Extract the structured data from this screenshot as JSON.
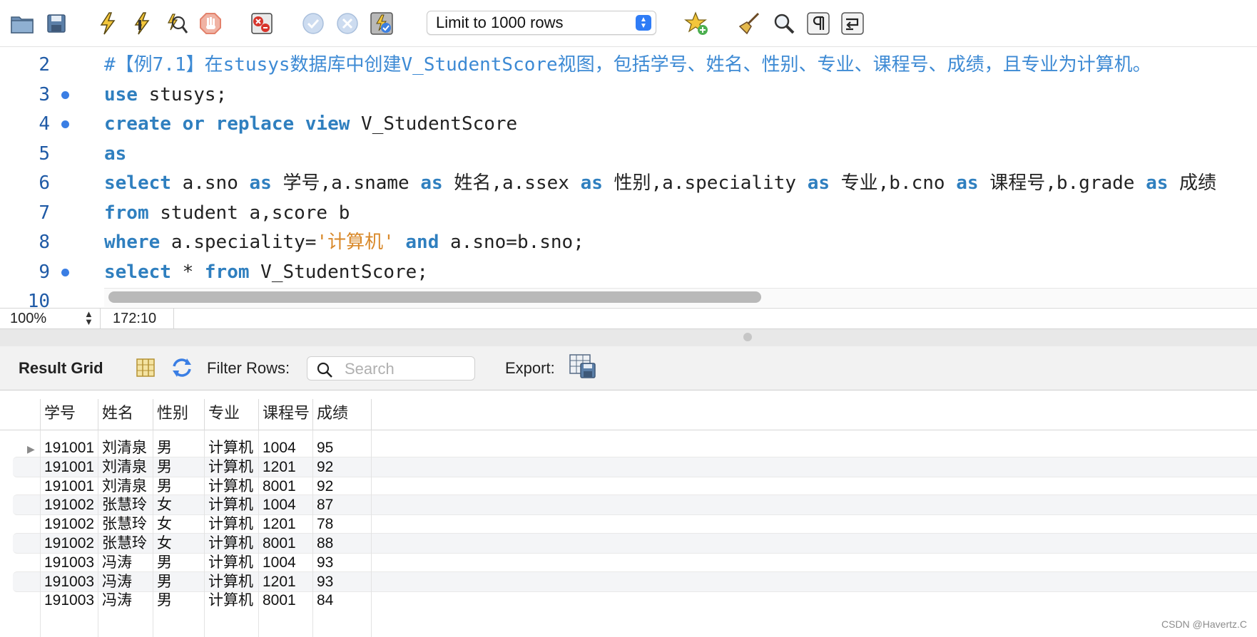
{
  "toolbar": {
    "icons": [
      "open-folder-icon",
      "save-icon",
      "execute-icon",
      "execute-current-icon",
      "explain-icon",
      "stop-icon",
      "toggle-stop-on-error-icon",
      "commit-icon",
      "rollback-icon",
      "autocommit-icon",
      "bookmark-icon",
      "beautify-icon",
      "find-icon",
      "invisible-chars-icon",
      "word-wrap-icon"
    ],
    "limit_select": "Limit to 1000 rows"
  },
  "editor": {
    "lines": [
      {
        "number": "2",
        "breakpoint": false,
        "tokens": [
          {
            "t": "#【例7.1】在stusys数据库中创建V_StudentScore视图，包括学号、姓名、性别、专业、课程号、成绩，且专业为计算机。",
            "c": "cm"
          }
        ]
      },
      {
        "number": "3",
        "breakpoint": true,
        "tokens": [
          {
            "t": "use",
            "c": "kw"
          },
          {
            "t": " stusys;",
            "c": ""
          }
        ]
      },
      {
        "number": "4",
        "breakpoint": true,
        "tokens": [
          {
            "t": "create",
            "c": "kw"
          },
          {
            "t": " ",
            "c": ""
          },
          {
            "t": "or",
            "c": "kw"
          },
          {
            "t": " ",
            "c": ""
          },
          {
            "t": "replace",
            "c": "kw"
          },
          {
            "t": " ",
            "c": ""
          },
          {
            "t": "view",
            "c": "kw"
          },
          {
            "t": " V_StudentScore",
            "c": ""
          }
        ]
      },
      {
        "number": "5",
        "breakpoint": false,
        "tokens": [
          {
            "t": "as",
            "c": "kw"
          }
        ]
      },
      {
        "number": "6",
        "breakpoint": false,
        "tokens": [
          {
            "t": "select",
            "c": "kw"
          },
          {
            "t": " a.sno ",
            "c": ""
          },
          {
            "t": "as",
            "c": "kw"
          },
          {
            "t": " 学号,a.sname ",
            "c": ""
          },
          {
            "t": "as",
            "c": "kw"
          },
          {
            "t": " 姓名,a.ssex ",
            "c": ""
          },
          {
            "t": "as",
            "c": "kw"
          },
          {
            "t": " 性别,a.speciality ",
            "c": ""
          },
          {
            "t": "as",
            "c": "kw"
          },
          {
            "t": " 专业,b.cno ",
            "c": ""
          },
          {
            "t": "as",
            "c": "kw"
          },
          {
            "t": " 课程号,b.grade ",
            "c": ""
          },
          {
            "t": "as",
            "c": "kw"
          },
          {
            "t": " 成绩",
            "c": ""
          }
        ]
      },
      {
        "number": "7",
        "breakpoint": false,
        "tokens": [
          {
            "t": "from",
            "c": "kw"
          },
          {
            "t": " student a,score b",
            "c": ""
          }
        ]
      },
      {
        "number": "8",
        "breakpoint": false,
        "tokens": [
          {
            "t": "where",
            "c": "kw"
          },
          {
            "t": " a.speciality=",
            "c": ""
          },
          {
            "t": "'计算机'",
            "c": "str"
          },
          {
            "t": " ",
            "c": ""
          },
          {
            "t": "and",
            "c": "kw"
          },
          {
            "t": " a.sno=b.sno;",
            "c": ""
          }
        ]
      },
      {
        "number": "9",
        "breakpoint": true,
        "tokens": [
          {
            "t": "select",
            "c": "kw"
          },
          {
            "t": " * ",
            "c": ""
          },
          {
            "t": "from",
            "c": "kw"
          },
          {
            "t": " V_StudentScore;",
            "c": ""
          }
        ]
      },
      {
        "number": "10",
        "breakpoint": false,
        "tokens": []
      }
    ]
  },
  "statusbar": {
    "zoom": "100%",
    "cursor_position": "172:10"
  },
  "result_toolbar": {
    "title": "Result Grid",
    "filter_label": "Filter Rows:",
    "search_placeholder": "Search",
    "export_label": "Export:"
  },
  "grid": {
    "columns": [
      "学号",
      "姓名",
      "性别",
      "专业",
      "课程号",
      "成绩"
    ],
    "rows": [
      [
        "191001",
        "刘清泉",
        "男",
        "计算机",
        "1004",
        "95"
      ],
      [
        "191001",
        "刘清泉",
        "男",
        "计算机",
        "1201",
        "92"
      ],
      [
        "191001",
        "刘清泉",
        "男",
        "计算机",
        "8001",
        "92"
      ],
      [
        "191002",
        "张慧玲",
        "女",
        "计算机",
        "1004",
        "87"
      ],
      [
        "191002",
        "张慧玲",
        "女",
        "计算机",
        "1201",
        "78"
      ],
      [
        "191002",
        "张慧玲",
        "女",
        "计算机",
        "8001",
        "88"
      ],
      [
        "191003",
        "冯涛",
        "男",
        "计算机",
        "1004",
        "93"
      ],
      [
        "191003",
        "冯涛",
        "男",
        "计算机",
        "1201",
        "93"
      ],
      [
        "191003",
        "冯涛",
        "男",
        "计算机",
        "8001",
        "84"
      ]
    ],
    "selected_row_marker": "▶"
  },
  "watermark": "CSDN @Havertz.C",
  "colors": {
    "keyword": "#2f7fbf",
    "comment": "#3d8ad4",
    "string": "#d9892a",
    "line_number": "#1f5aa6",
    "breakpoint": "#3a7ee4",
    "accent": "#2f7cf6"
  }
}
